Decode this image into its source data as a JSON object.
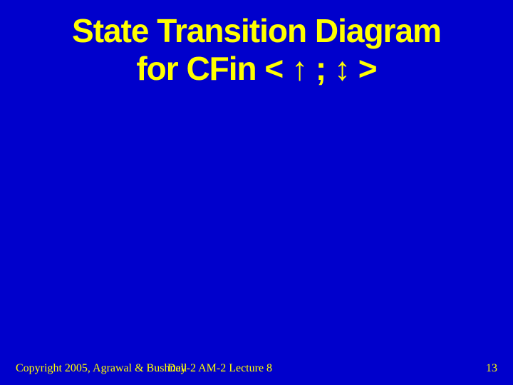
{
  "title": {
    "line1": "State Transition Diagram",
    "line2_prefix": "for CFin < ",
    "arrow_up": "↑",
    "line2_mid": " ; ",
    "arrow_updown": "↕",
    "line2_suffix": " >"
  },
  "footer": {
    "copyright": "Copyright 2005, Agrawal & Bushnell",
    "lecture": "Day-2 AM-2 Lecture 8",
    "page": "13"
  }
}
